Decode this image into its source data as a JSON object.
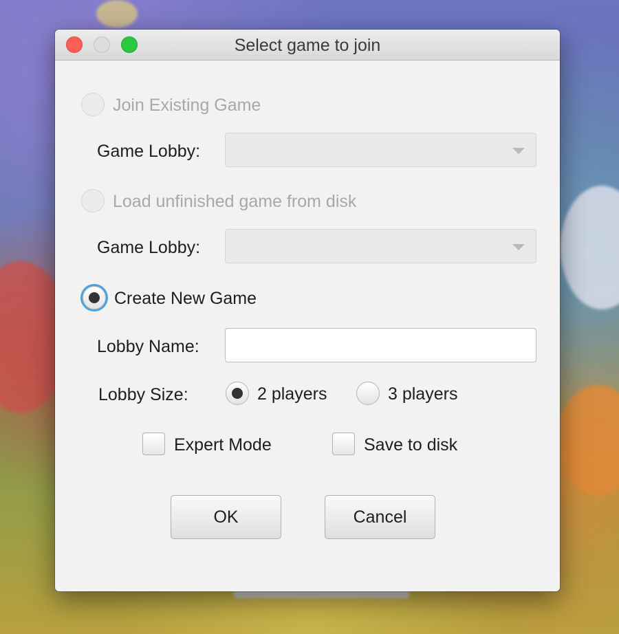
{
  "window": {
    "title": "Select game to join"
  },
  "options": {
    "join_existing": {
      "label": "Join Existing Game",
      "selected": false,
      "enabled": false
    },
    "join_lobby_label": "Game Lobby:",
    "join_lobby_value": "",
    "load_unfinished": {
      "label": "Load unfinished game from disk",
      "selected": false,
      "enabled": false
    },
    "load_lobby_label": "Game Lobby:",
    "load_lobby_value": "",
    "create_new": {
      "label": "Create New Game",
      "selected": true,
      "enabled": true
    }
  },
  "create": {
    "lobby_name_label": "Lobby Name:",
    "lobby_name_value": "",
    "lobby_size_label": "Lobby Size:",
    "size_options": [
      {
        "label": "2 players",
        "selected": true
      },
      {
        "label": "3 players",
        "selected": false
      }
    ],
    "expert_mode": {
      "label": "Expert Mode",
      "checked": false
    },
    "save_to_disk": {
      "label": "Save to disk",
      "checked": false
    }
  },
  "buttons": {
    "ok_label": "OK",
    "cancel_label": "Cancel"
  },
  "colors": {
    "focus_ring": "#4ba1e0",
    "close_button": "#fc5f57",
    "maximize_button": "#2ac940"
  }
}
